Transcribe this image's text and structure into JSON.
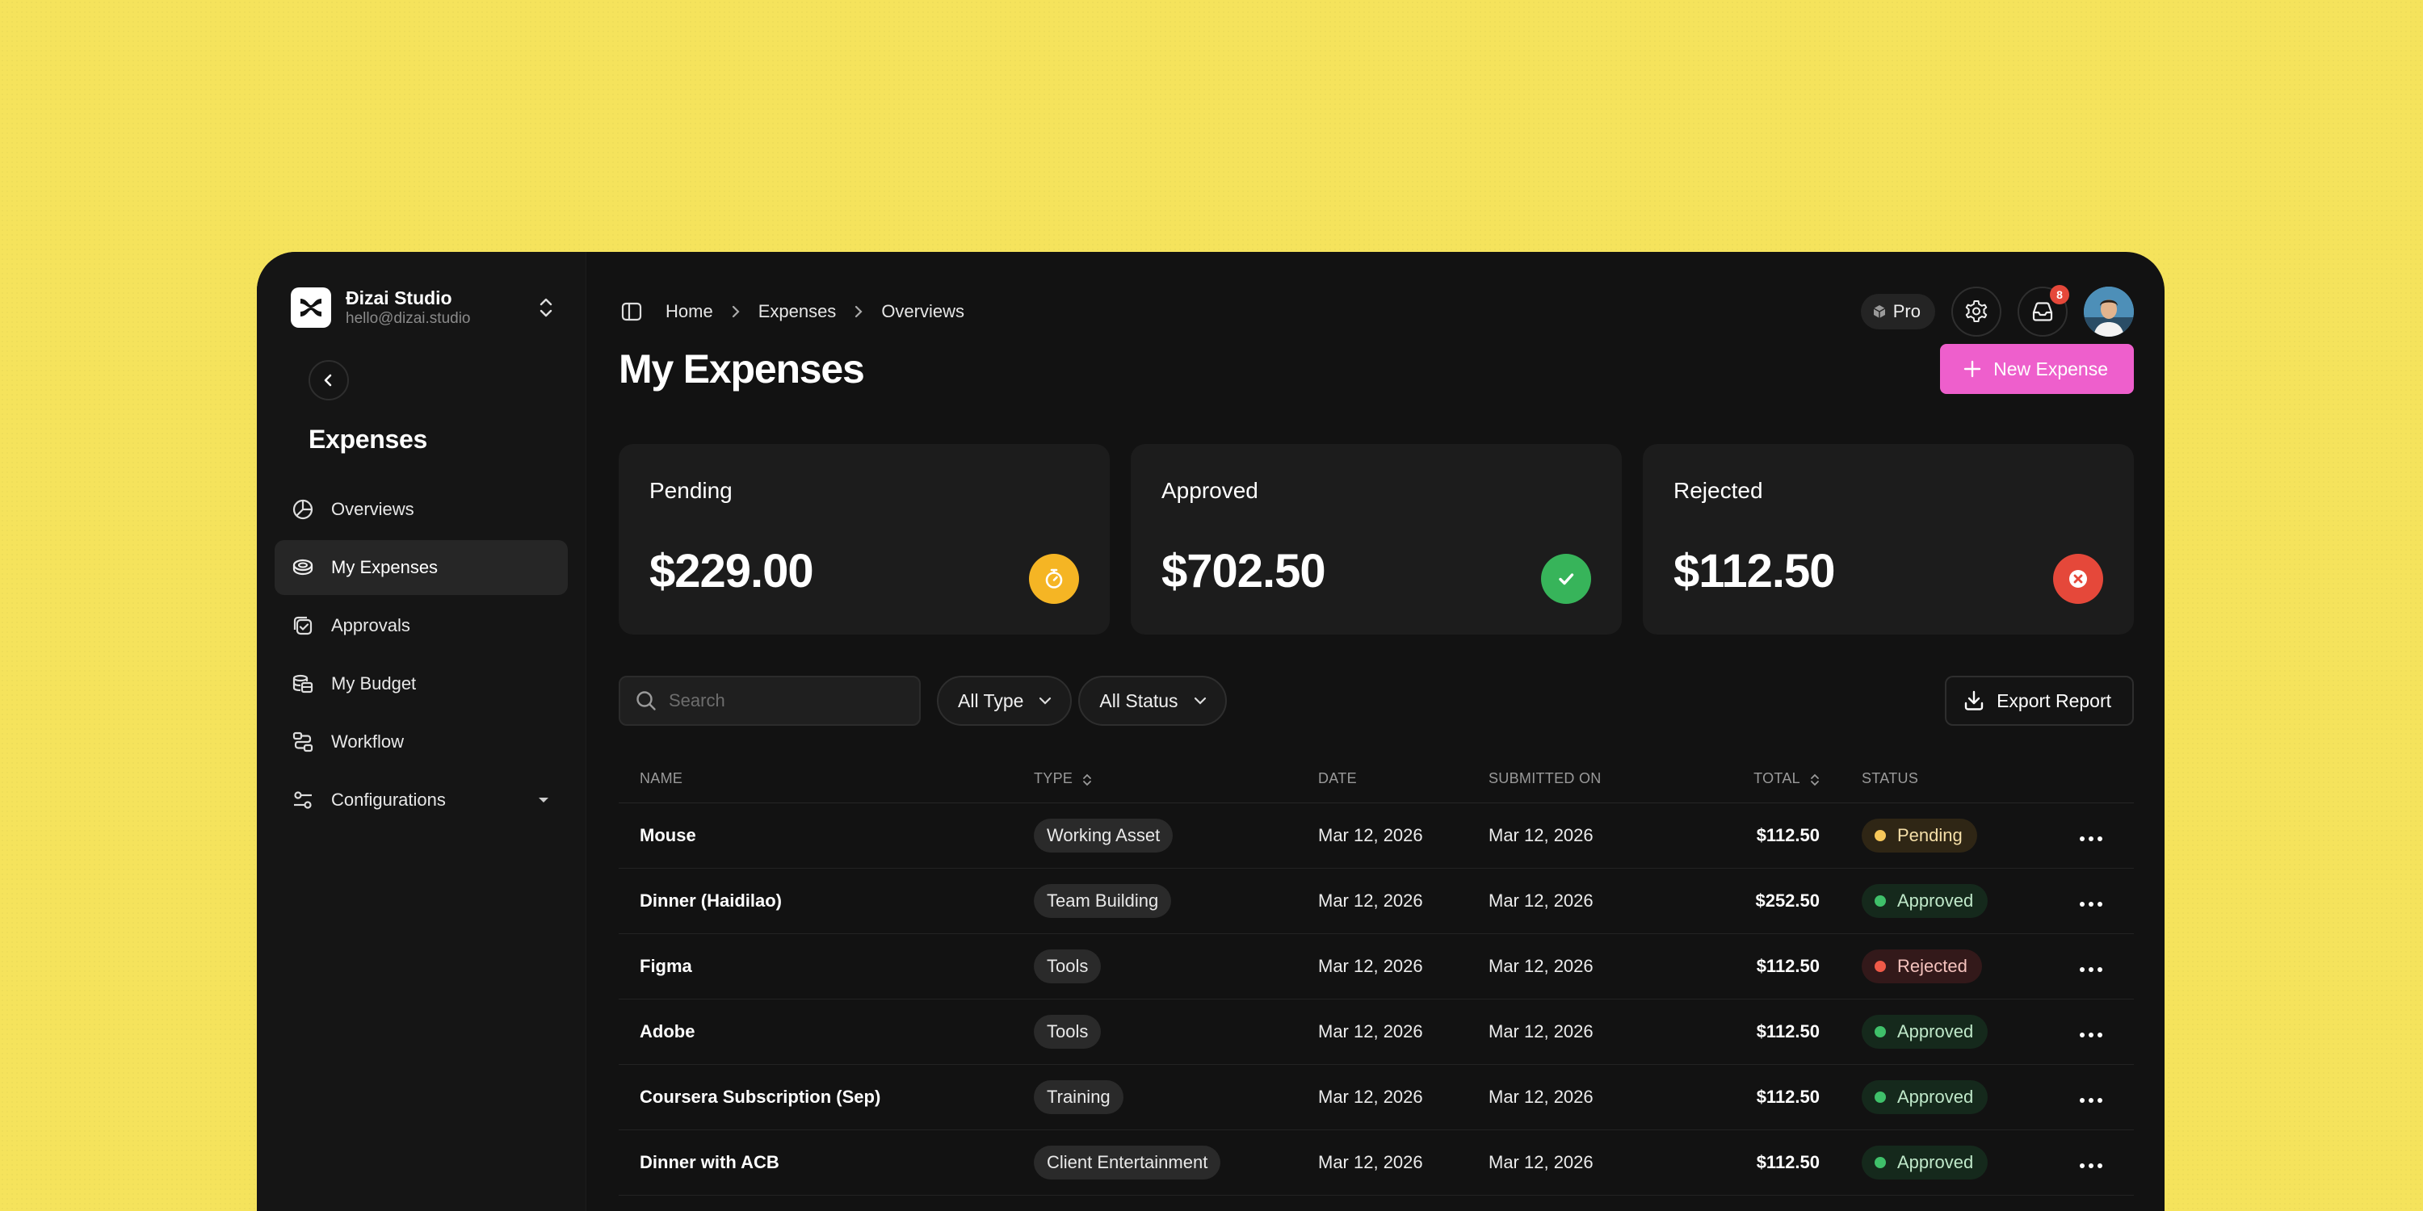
{
  "workspace": {
    "name": "Đizai Studio",
    "email": "hello@dizai.studio"
  },
  "sidebar": {
    "title": "Expenses",
    "items": [
      {
        "label": "Overviews",
        "icon": "pie-chart-icon",
        "active": false
      },
      {
        "label": "My Expenses",
        "icon": "coins-icon",
        "active": true
      },
      {
        "label": "Approvals",
        "icon": "approval-icon",
        "active": false
      },
      {
        "label": "My Budget",
        "icon": "budget-icon",
        "active": false
      },
      {
        "label": "Workflow",
        "icon": "workflow-icon",
        "active": false
      },
      {
        "label": "Configurations",
        "icon": "sliders-icon",
        "active": false,
        "has_submenu": true
      }
    ]
  },
  "breadcrumb": [
    "Home",
    "Expenses",
    "Overviews"
  ],
  "topbar": {
    "plan_label": "Pro",
    "notification_count": "8"
  },
  "page": {
    "title": "My Expenses",
    "new_button_label": "New Expense"
  },
  "summary": [
    {
      "label": "Pending",
      "value": "$229.00",
      "color": "#f5b524",
      "icon": "timer-icon"
    },
    {
      "label": "Approved",
      "value": "$702.50",
      "color": "#37b45a",
      "icon": "check-icon"
    },
    {
      "label": "Rejected",
      "value": "$112.50",
      "color": "#e5483a",
      "icon": "x-circle-icon"
    }
  ],
  "filters": {
    "search_placeholder": "Search",
    "type_select": "All Type",
    "status_select": "All Status",
    "export_label": "Export Report"
  },
  "table": {
    "columns": [
      "NAME",
      "TYPE",
      "DATE",
      "SUBMITTED ON",
      "TOTAL",
      "STATUS"
    ],
    "rows": [
      {
        "name": "Mouse",
        "type": "Working Asset",
        "date": "Mar 12, 2026",
        "submitted": "Mar 12, 2026",
        "total": "$112.50",
        "status": "Pending"
      },
      {
        "name": "Dinner (Haidilao)",
        "type": "Team Building",
        "date": "Mar 12, 2026",
        "submitted": "Mar 12, 2026",
        "total": "$252.50",
        "status": "Approved"
      },
      {
        "name": "Figma",
        "type": "Tools",
        "date": "Mar 12, 2026",
        "submitted": "Mar 12, 2026",
        "total": "$112.50",
        "status": "Rejected"
      },
      {
        "name": "Adobe",
        "type": "Tools",
        "date": "Mar 12, 2026",
        "submitted": "Mar 12, 2026",
        "total": "$112.50",
        "status": "Approved"
      },
      {
        "name": "Coursera Subscription (Sep)",
        "type": "Training",
        "date": "Mar 12, 2026",
        "submitted": "Mar 12, 2026",
        "total": "$112.50",
        "status": "Approved"
      },
      {
        "name": "Dinner with ACB",
        "type": "Client Entertainment",
        "date": "Mar 12, 2026",
        "submitted": "Mar 12, 2026",
        "total": "$112.50",
        "status": "Approved"
      }
    ]
  },
  "colors": {
    "accent": "#ee5fcc",
    "background": "#f5e35c",
    "app": "#121212"
  }
}
